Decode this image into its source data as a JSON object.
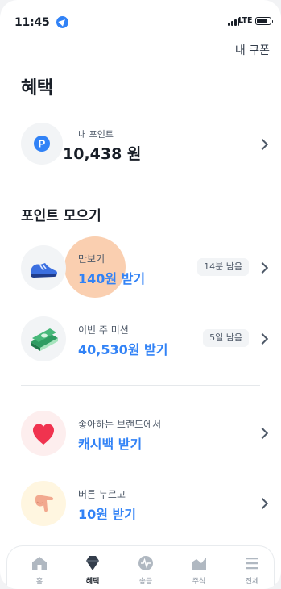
{
  "status_bar": {
    "time": "11:45",
    "network": "LTE"
  },
  "header": {
    "coupon_label": "내 쿠폰"
  },
  "page": {
    "title": "혜택"
  },
  "points": {
    "label": "내 포인트",
    "value": "10,438 원",
    "icon": "point-p-icon"
  },
  "section": {
    "title": "포인트 모으기"
  },
  "missions": [
    {
      "name": "만보기",
      "reward": "140원 받기",
      "badge": "14분 남음",
      "icon": "sneaker-icon"
    },
    {
      "name": "이번 주 미션",
      "reward": "40,530원 받기",
      "badge": "5일 남음",
      "icon": "money-stack-icon"
    }
  ],
  "others": [
    {
      "name": "좋아하는 브랜드에서",
      "reward": "캐시백 받기",
      "icon": "heart-icon"
    },
    {
      "name": "버튼 누르고",
      "reward": "10원 받기",
      "icon": "pointing-hand-icon"
    }
  ],
  "tabs": [
    {
      "label": "홈",
      "icon": "home-icon",
      "active": false
    },
    {
      "label": "혜택",
      "icon": "gem-icon",
      "active": true
    },
    {
      "label": "송금",
      "icon": "transfer-icon",
      "active": false
    },
    {
      "label": "주식",
      "icon": "stock-chart-icon",
      "active": false
    },
    {
      "label": "전체",
      "icon": "menu-icon",
      "active": false
    }
  ],
  "colors": {
    "accent": "#3182f6",
    "text": "#191f28",
    "highlight": "#f7b280"
  }
}
